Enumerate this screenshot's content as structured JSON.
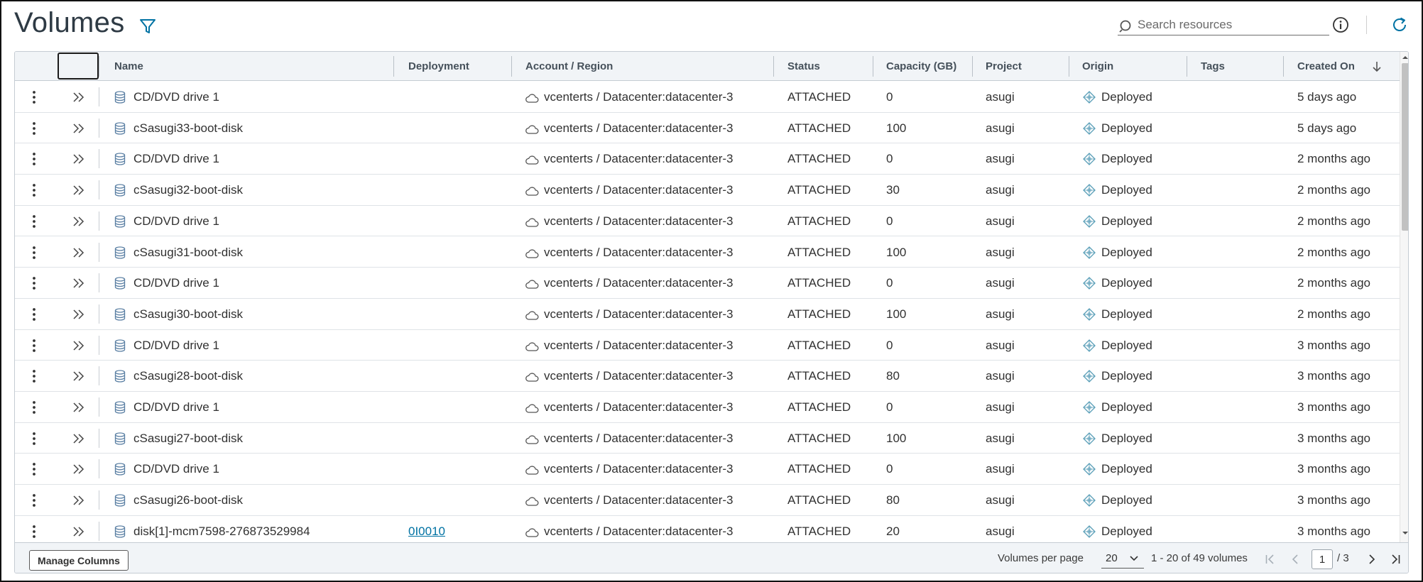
{
  "header": {
    "title": "Volumes",
    "search_placeholder": "Search resources"
  },
  "colors": {
    "accent": "#0072a3",
    "icon_blue": "#5a7fa3",
    "title": "#2e3a44",
    "header_bg": "#f1f4f7",
    "border": "#c5ccd3"
  },
  "icons": {
    "filter": "filter-icon",
    "search": "search-icon",
    "info": "info-icon",
    "refresh": "refresh-icon",
    "row_menu": "vertical-dots-icon",
    "row_expand": "double-chevron-right-icon",
    "disk": "database-disk-icon",
    "cloud": "cloud-icon",
    "origin": "deployment-diamond-icon",
    "sort": "arrow-down-icon"
  },
  "table": {
    "columns": [
      "Name",
      "Deployment",
      "Account / Region",
      "Status",
      "Capacity (GB)",
      "Project",
      "Origin",
      "Tags",
      "Created On"
    ],
    "rows": [
      {
        "name": "CD/DVD drive 1",
        "deployment": "",
        "account": "vcenterts / Datacenter:datacenter-3",
        "status": "ATTACHED",
        "capacity": "0",
        "project": "asugi",
        "origin": "Deployed",
        "tags": "",
        "created": "5 days ago"
      },
      {
        "name": "cSasugi33-boot-disk",
        "deployment": "",
        "account": "vcenterts / Datacenter:datacenter-3",
        "status": "ATTACHED",
        "capacity": "100",
        "project": "asugi",
        "origin": "Deployed",
        "tags": "",
        "created": "5 days ago"
      },
      {
        "name": "CD/DVD drive 1",
        "deployment": "",
        "account": "vcenterts / Datacenter:datacenter-3",
        "status": "ATTACHED",
        "capacity": "0",
        "project": "asugi",
        "origin": "Deployed",
        "tags": "",
        "created": "2 months ago"
      },
      {
        "name": "cSasugi32-boot-disk",
        "deployment": "",
        "account": "vcenterts / Datacenter:datacenter-3",
        "status": "ATTACHED",
        "capacity": "30",
        "project": "asugi",
        "origin": "Deployed",
        "tags": "",
        "created": "2 months ago"
      },
      {
        "name": "CD/DVD drive 1",
        "deployment": "",
        "account": "vcenterts / Datacenter:datacenter-3",
        "status": "ATTACHED",
        "capacity": "0",
        "project": "asugi",
        "origin": "Deployed",
        "tags": "",
        "created": "2 months ago"
      },
      {
        "name": "cSasugi31-boot-disk",
        "deployment": "",
        "account": "vcenterts / Datacenter:datacenter-3",
        "status": "ATTACHED",
        "capacity": "100",
        "project": "asugi",
        "origin": "Deployed",
        "tags": "",
        "created": "2 months ago"
      },
      {
        "name": "CD/DVD drive 1",
        "deployment": "",
        "account": "vcenterts / Datacenter:datacenter-3",
        "status": "ATTACHED",
        "capacity": "0",
        "project": "asugi",
        "origin": "Deployed",
        "tags": "",
        "created": "2 months ago"
      },
      {
        "name": "cSasugi30-boot-disk",
        "deployment": "",
        "account": "vcenterts / Datacenter:datacenter-3",
        "status": "ATTACHED",
        "capacity": "100",
        "project": "asugi",
        "origin": "Deployed",
        "tags": "",
        "created": "2 months ago"
      },
      {
        "name": "CD/DVD drive 1",
        "deployment": "",
        "account": "vcenterts / Datacenter:datacenter-3",
        "status": "ATTACHED",
        "capacity": "0",
        "project": "asugi",
        "origin": "Deployed",
        "tags": "",
        "created": "3 months ago"
      },
      {
        "name": "cSasugi28-boot-disk",
        "deployment": "",
        "account": "vcenterts / Datacenter:datacenter-3",
        "status": "ATTACHED",
        "capacity": "80",
        "project": "asugi",
        "origin": "Deployed",
        "tags": "",
        "created": "3 months ago"
      },
      {
        "name": "CD/DVD drive 1",
        "deployment": "",
        "account": "vcenterts / Datacenter:datacenter-3",
        "status": "ATTACHED",
        "capacity": "0",
        "project": "asugi",
        "origin": "Deployed",
        "tags": "",
        "created": "3 months ago"
      },
      {
        "name": "cSasugi27-boot-disk",
        "deployment": "",
        "account": "vcenterts / Datacenter:datacenter-3",
        "status": "ATTACHED",
        "capacity": "100",
        "project": "asugi",
        "origin": "Deployed",
        "tags": "",
        "created": "3 months ago"
      },
      {
        "name": "CD/DVD drive 1",
        "deployment": "",
        "account": "vcenterts / Datacenter:datacenter-3",
        "status": "ATTACHED",
        "capacity": "0",
        "project": "asugi",
        "origin": "Deployed",
        "tags": "",
        "created": "3 months ago"
      },
      {
        "name": "cSasugi26-boot-disk",
        "deployment": "",
        "account": "vcenterts / Datacenter:datacenter-3",
        "status": "ATTACHED",
        "capacity": "80",
        "project": "asugi",
        "origin": "Deployed",
        "tags": "",
        "created": "3 months ago"
      },
      {
        "name": "disk[1]-mcm7598-276873529984",
        "deployment": "0I0010",
        "account": "vcenterts / Datacenter:datacenter-3",
        "status": "ATTACHED",
        "capacity": "20",
        "project": "asugi",
        "origin": "Deployed",
        "tags": "",
        "created": "3 months ago"
      }
    ]
  },
  "footer": {
    "manage_columns_label": "Manage Columns",
    "per_page_label": "Volumes per page",
    "per_page_value": "20",
    "range_text": "1 - 20 of 49 volumes",
    "current_page": "1",
    "total_pages_text": "/ 3"
  }
}
